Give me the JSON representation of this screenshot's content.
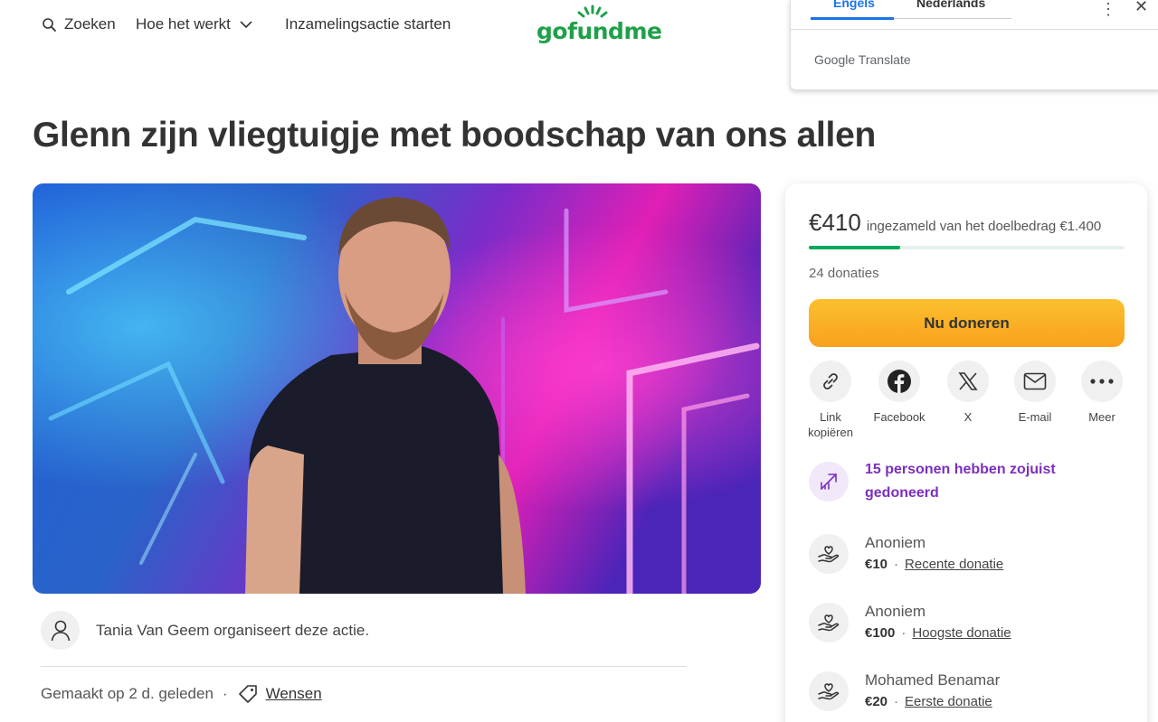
{
  "nav": {
    "search_label": "Zoeken",
    "how_label": "Hoe het werkt",
    "start_label": "Inzamelingsactie starten",
    "logo_text": "gofundme"
  },
  "translate": {
    "tab_source": "Engels",
    "tab_target": "Nederlands",
    "brand_google": "Google",
    "brand_translate": "Translate"
  },
  "campaign": {
    "title": "Glenn zijn vliegtuigje met boodschap van ons allen",
    "organizer_text": "Tania Van Geem organiseert deze actie.",
    "created_text": "Gemaakt op 2 d. geleden",
    "separator": "·",
    "wishes_label": "Wensen"
  },
  "donation_card": {
    "raised": "€410",
    "raised_sub": "ingezameld van het doelbedrag €1.400",
    "progress_fraction": 0.29,
    "donations_count": "24 donaties",
    "donate_button": "Nu doneren",
    "share": [
      {
        "label": "Link kopiëren",
        "icon": "link-icon"
      },
      {
        "label": "Facebook",
        "icon": "facebook-icon"
      },
      {
        "label": "X",
        "icon": "x-icon"
      },
      {
        "label": "E-mail",
        "icon": "mail-icon"
      },
      {
        "label": "Meer",
        "icon": "more-icon"
      }
    ],
    "recent_activity": "15 personen hebben zojuist gedoneerd",
    "donors": [
      {
        "name": "Anoniem",
        "amount": "€10",
        "tag": "Recente donatie"
      },
      {
        "name": "Anoniem",
        "amount": "€100",
        "tag": "Hoogste donatie"
      },
      {
        "name": "Mohamed Benamar",
        "amount": "€20",
        "tag": "Eerste donatie"
      }
    ]
  },
  "colors": {
    "brand_green": "#02a95c",
    "donate_orange": "#f8a11e",
    "recent_purple": "#7b2fbe",
    "translate_blue": "#1a73e8"
  }
}
